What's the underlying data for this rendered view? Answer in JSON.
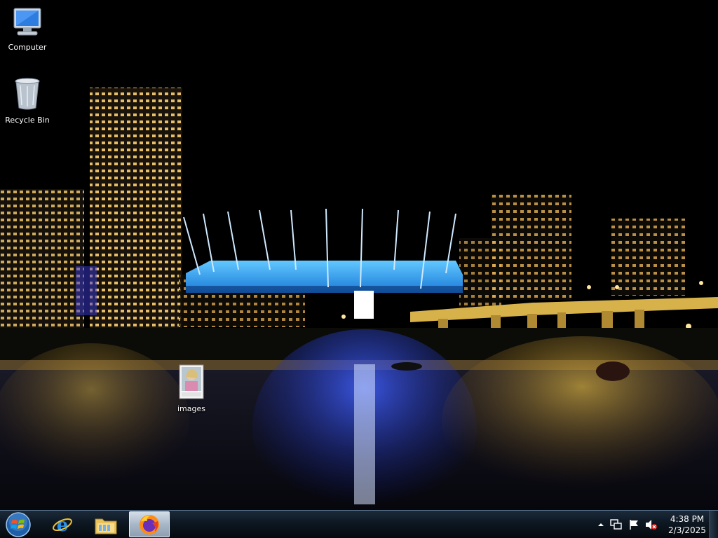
{
  "desktop": {
    "icons": [
      {
        "label": "Computer",
        "icon": "computer-icon"
      },
      {
        "label": "Recycle Bin",
        "icon": "recycle-bin-icon"
      },
      {
        "label": "images",
        "icon": "image-file-icon"
      }
    ]
  },
  "taskbar": {
    "start": "start-orb",
    "pinned": [
      {
        "icon": "internet-explorer-icon",
        "active": false
      },
      {
        "icon": "file-explorer-icon",
        "active": false
      },
      {
        "icon": "firefox-icon",
        "active": true
      }
    ],
    "tray": {
      "icons": [
        "show-hidden-icons-arrow",
        "network-icon",
        "action-center-flag-icon",
        "volume-muted-icon"
      ],
      "time": "4:38 PM",
      "date": "2/3/2025"
    }
  },
  "colors": {
    "stadium_glow": "#29a8ff",
    "city_lights": "#ffd36a",
    "taskbar": "#0d1722"
  }
}
